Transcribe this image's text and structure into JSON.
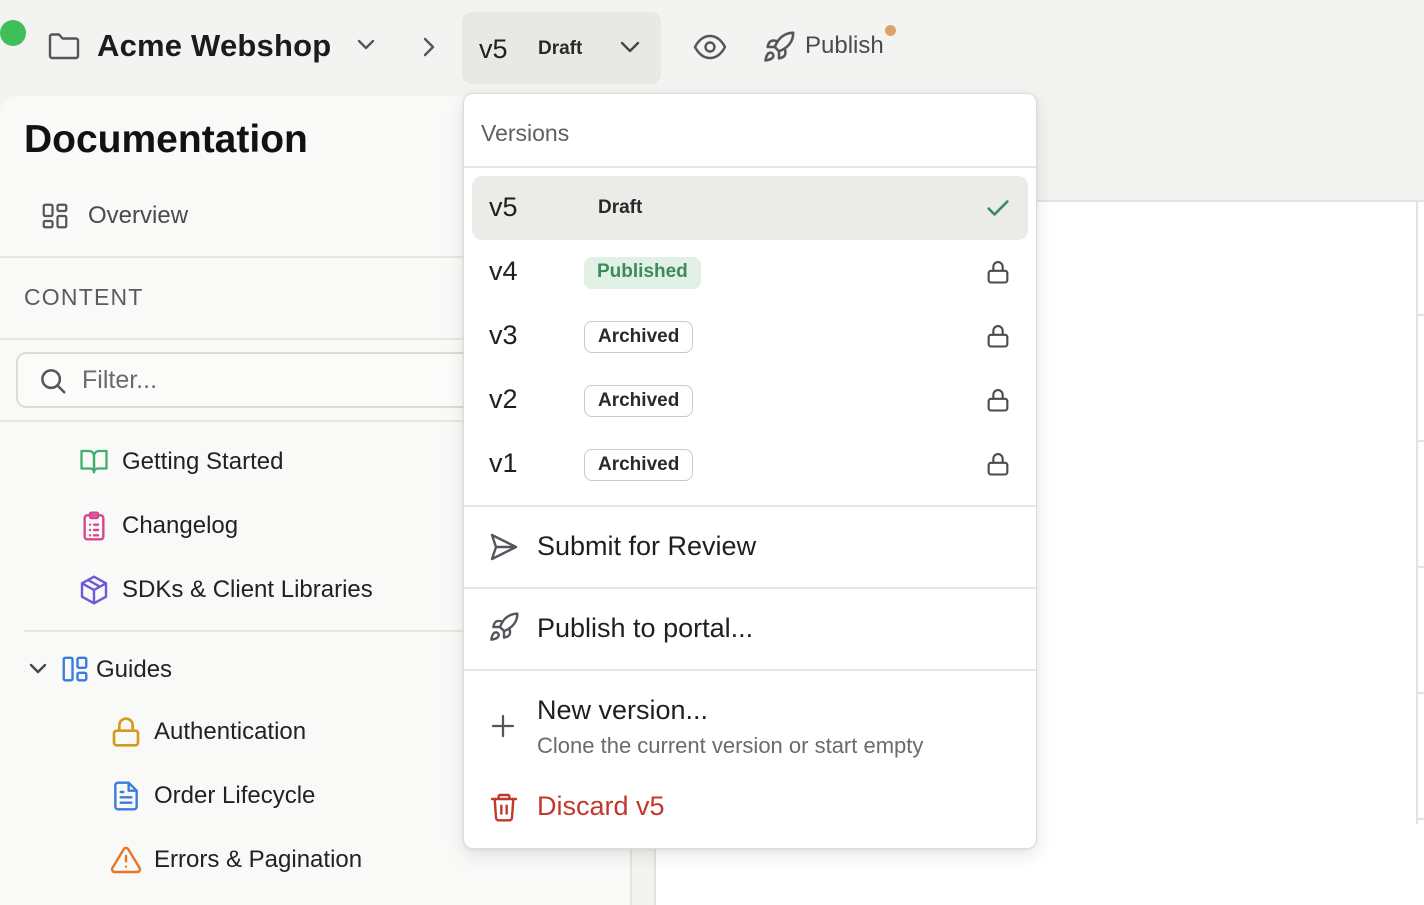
{
  "header": {
    "project_name": "Acme Webshop",
    "version_label": "v5",
    "version_status": "Draft",
    "publish_label": "Publish"
  },
  "sidebar": {
    "title": "Documentation",
    "overview_label": "Overview",
    "section_label": "CONTENT",
    "filter_placeholder": "Filter...",
    "items": [
      {
        "label": "Getting Started",
        "icon": "book-open-icon",
        "color": "#3fae6a"
      },
      {
        "label": "Changelog",
        "icon": "clipboard-list-icon",
        "color": "#d6478f"
      },
      {
        "label": "SDKs & Client Libraries",
        "icon": "package-icon",
        "color": "#6b5bd8"
      }
    ],
    "group": {
      "label": "Guides",
      "icon": "layout-icon",
      "color": "#3b7be0",
      "children": [
        {
          "label": "Authentication",
          "icon": "lock-icon",
          "color": "#d39a1e"
        },
        {
          "label": "Order Lifecycle",
          "icon": "file-text-icon",
          "color": "#3b7be0"
        },
        {
          "label": "Errors & Pagination",
          "icon": "alert-triangle-icon",
          "color": "#e87722"
        }
      ]
    }
  },
  "dropdown": {
    "header": "Versions",
    "versions": [
      {
        "label": "v5",
        "status": "Draft",
        "selected": true,
        "icon": "check-icon"
      },
      {
        "label": "v4",
        "status": "Published",
        "selected": false,
        "icon": "lock-icon"
      },
      {
        "label": "v3",
        "status": "Archived",
        "selected": false,
        "icon": "lock-icon"
      },
      {
        "label": "v2",
        "status": "Archived",
        "selected": false,
        "icon": "lock-icon"
      },
      {
        "label": "v1",
        "status": "Archived",
        "selected": false,
        "icon": "lock-icon"
      }
    ],
    "actions": {
      "submit_review": "Submit for Review",
      "publish_portal": "Publish to portal...",
      "new_version": "New version...",
      "new_version_sub": "Clone the current version or start empty",
      "discard": "Discard v5"
    }
  },
  "colors": {
    "accent_green": "#3fbf5a",
    "notify_dot": "#dea06a",
    "danger": "#c0392b",
    "published_badge_bg": "#e1f1e6",
    "published_badge_text": "#3d8a5a"
  }
}
